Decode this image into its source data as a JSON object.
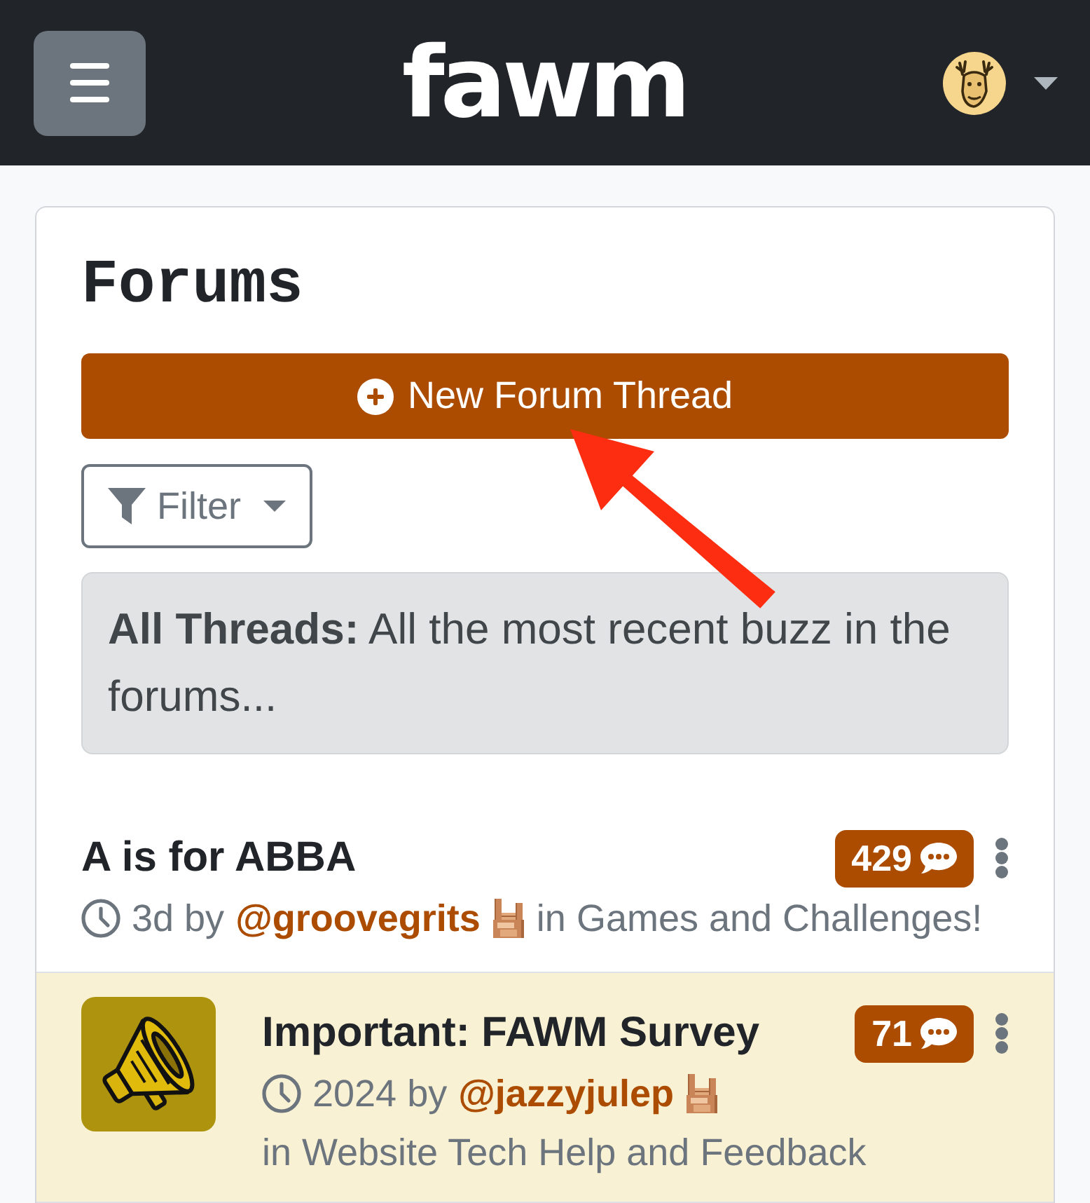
{
  "header": {
    "logo": "fawm"
  },
  "page": {
    "title": "Forums",
    "new_thread_button": "New Forum Thread",
    "filter_button": "Filter",
    "info": "**All Threads:** All the most recent buzz in the forums..."
  },
  "threads": [
    {
      "kind": "regular",
      "highlighted": false,
      "title": "A is for ABBA",
      "count": "429",
      "time": "3d by",
      "author": "@groovegrits",
      "category": "in Games and Challenges!"
    },
    {
      "kind": "announcement",
      "highlighted": true,
      "title": "Important: FAWM Survey",
      "count": "71",
      "time": "2024 by",
      "author": "@jazzyjulep",
      "category": "in Website Tech Help and Feedback"
    }
  ],
  "annotation": {
    "kind": "arrow"
  }
}
